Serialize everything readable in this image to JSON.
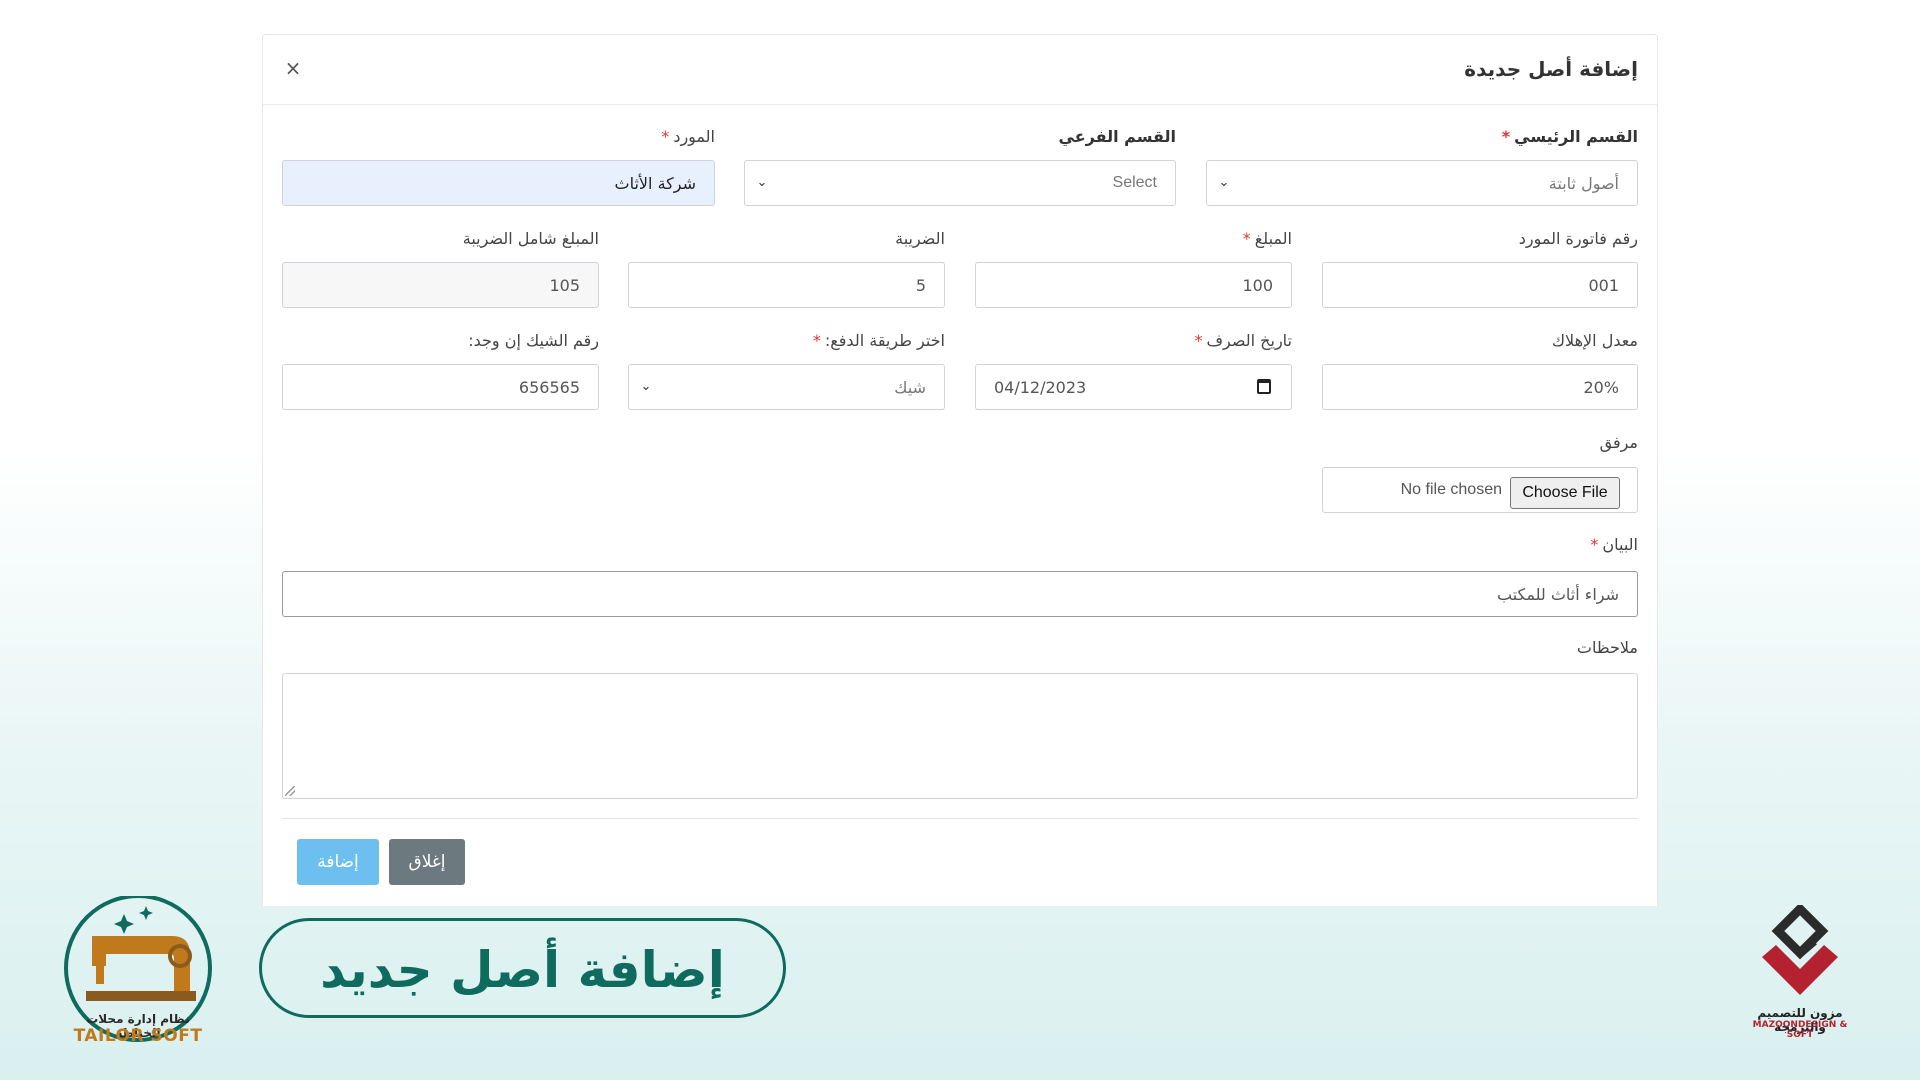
{
  "modal": {
    "title": "إضافة أصل جديدة",
    "close_label": "×"
  },
  "form": {
    "main_section": {
      "label": "القسم الرئيسي",
      "value": "أصول ثابتة"
    },
    "sub_section": {
      "label": "القسم الفرعي",
      "value": "Select"
    },
    "supplier": {
      "label": "المورد",
      "value": "شركة الأثاث"
    },
    "invoice_no": {
      "label": "رقم فاتورة المورد",
      "value": "001"
    },
    "amount": {
      "label": "المبلغ",
      "value": "100"
    },
    "tax": {
      "label": "الضريبة",
      "value": "5"
    },
    "amount_with_tax": {
      "label": "المبلغ شامل الضريبة",
      "value": "105"
    },
    "depreciation_rate": {
      "label": "معدل الإهلاك",
      "value": "20%"
    },
    "expense_date": {
      "label": "تاريخ الصرف",
      "value": "04/12/2023"
    },
    "payment_method": {
      "label": "اختر طريقة الدفع:",
      "value": "شيك"
    },
    "check_no": {
      "label": "رقم الشيك إن وجد:",
      "value": "656565"
    },
    "attachment": {
      "label": "مرفق",
      "button": "Choose File",
      "status": "No file chosen"
    },
    "statement": {
      "label": "البيان",
      "value": "شراء أثاث للمكتب"
    },
    "notes": {
      "label": "ملاحظات",
      "value": ""
    },
    "required_mark": "*"
  },
  "buttons": {
    "add": "إضافة",
    "close": "إغلاق"
  },
  "branding": {
    "left_subtitle": "نظام إدارة محلات الخياطة",
    "left_name": "TAILOR SOFT",
    "banner": "إضافة أصل جديد",
    "right_ar": "مزون للتصميم والبرمجة",
    "right_en": "MAZOONDESIGN & SOFT"
  },
  "colors": {
    "accent_primary": "#6cbfef",
    "accent_secondary": "#6c7a80",
    "banner": "#0e6b5d",
    "required": "#e3342f",
    "brand_red": "#b3222e",
    "brand_orange": "#c07a1c"
  }
}
